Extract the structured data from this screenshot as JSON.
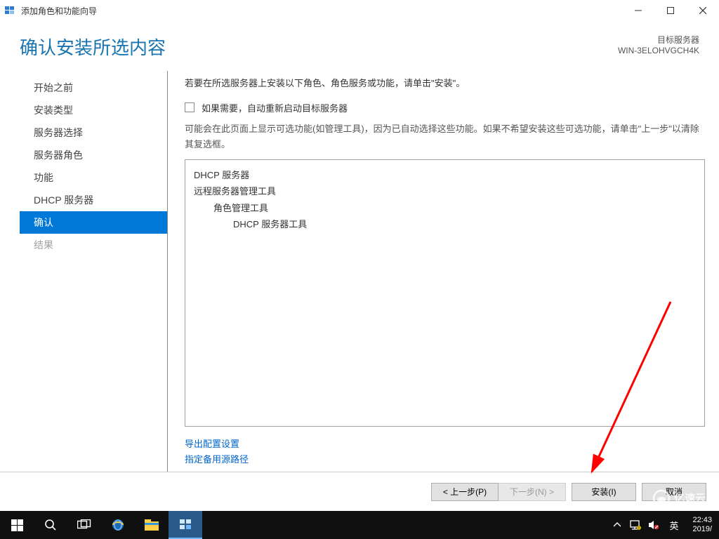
{
  "window": {
    "title": "添加角色和功能向导"
  },
  "header": {
    "page_title": "确认安装所选内容",
    "target_label": "目标服务器",
    "server_name": "WIN-3ELOHVGCH4K"
  },
  "nav": {
    "items": [
      {
        "label": "开始之前",
        "selected": false,
        "disabled": false
      },
      {
        "label": "安装类型",
        "selected": false,
        "disabled": false
      },
      {
        "label": "服务器选择",
        "selected": false,
        "disabled": false
      },
      {
        "label": "服务器角色",
        "selected": false,
        "disabled": false
      },
      {
        "label": "功能",
        "selected": false,
        "disabled": false
      },
      {
        "label": "DHCP 服务器",
        "selected": false,
        "disabled": false
      },
      {
        "label": "确认",
        "selected": true,
        "disabled": false
      },
      {
        "label": "结果",
        "selected": false,
        "disabled": true
      }
    ]
  },
  "content": {
    "instruction": "若要在所选服务器上安装以下角色、角色服务或功能，请单击\"安装\"。",
    "checkbox_label": "如果需要，自动重新启动目标服务器",
    "checkbox_checked": false,
    "note": "可能会在此页面上显示可选功能(如管理工具)，因为已自动选择这些功能。如果不希望安装这些可选功能，请单击\"上一步\"以清除其复选框。",
    "selections": [
      {
        "level": 1,
        "label": "DHCP 服务器"
      },
      {
        "level": 1,
        "label": "远程服务器管理工具"
      },
      {
        "level": 2,
        "label": "角色管理工具"
      },
      {
        "level": 3,
        "label": "DHCP 服务器工具"
      }
    ],
    "links": {
      "export": "导出配置设置",
      "alt_source": "指定备用源路径"
    }
  },
  "footer": {
    "prev": "< 上一步(P)",
    "next": "下一步(N) >",
    "install": "安装(I)",
    "cancel": "取消"
  },
  "taskbar": {
    "ime": "英",
    "time": "22:43",
    "date": "2019/"
  },
  "watermark": "亿速云"
}
